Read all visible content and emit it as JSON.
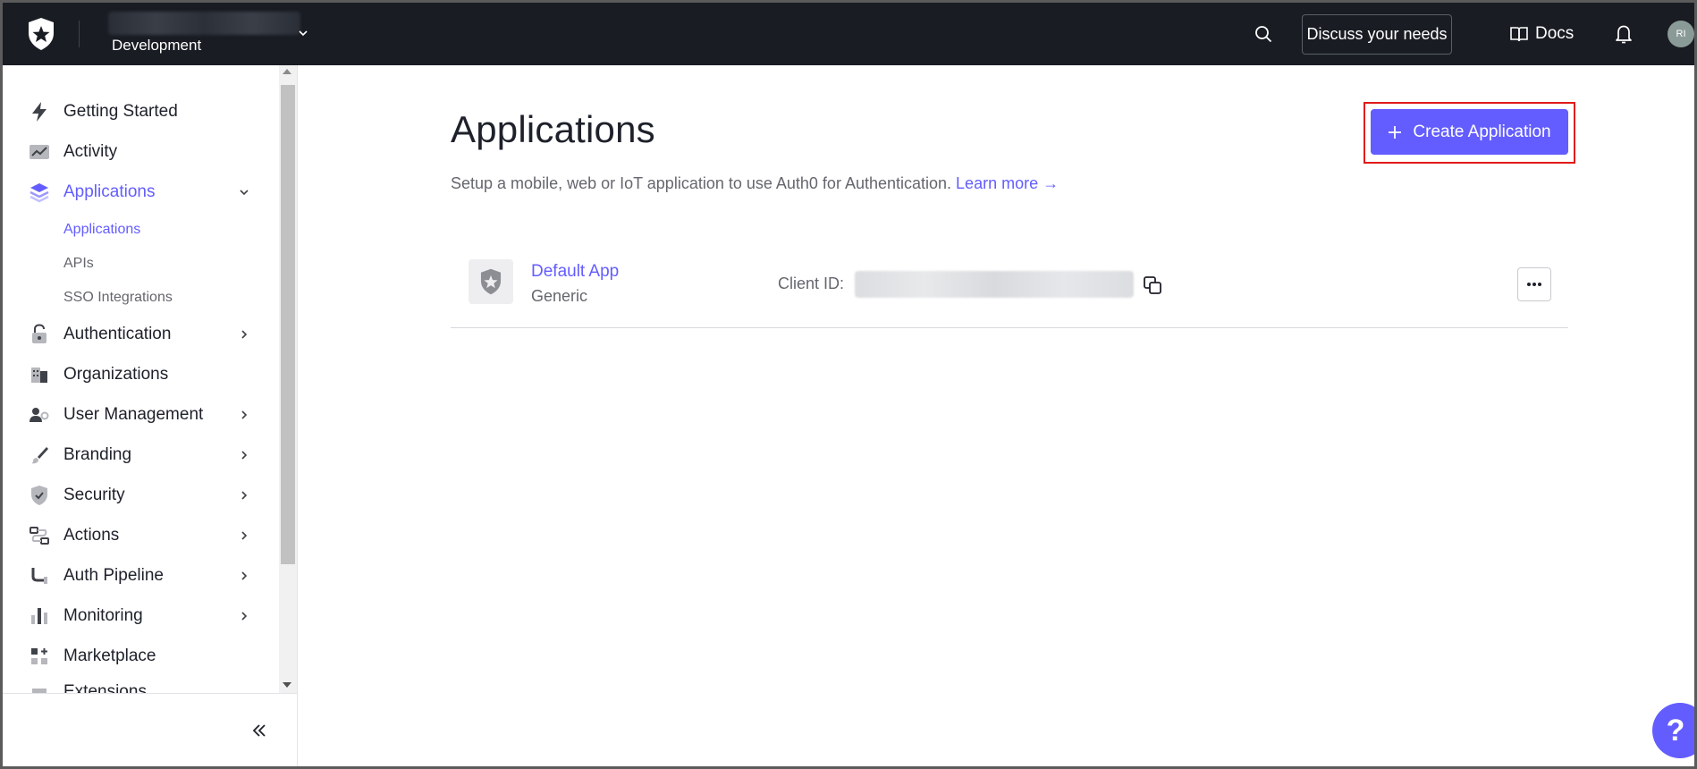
{
  "topbar": {
    "tenant_env": "Development",
    "discuss_label": "Discuss your needs",
    "docs_label": "Docs",
    "avatar_initials": "RI"
  },
  "sidebar": {
    "items": [
      {
        "label": "Getting Started",
        "icon": "bolt-icon"
      },
      {
        "label": "Activity",
        "icon": "activity-chart-icon"
      },
      {
        "label": "Applications",
        "icon": "layers-icon",
        "active": true,
        "expanded": true
      },
      {
        "label": "Authentication",
        "icon": "lock-icon"
      },
      {
        "label": "Organizations",
        "icon": "building-icon"
      },
      {
        "label": "User Management",
        "icon": "users-icon"
      },
      {
        "label": "Branding",
        "icon": "brush-icon"
      },
      {
        "label": "Security",
        "icon": "shield-icon"
      },
      {
        "label": "Actions",
        "icon": "actions-flow-icon"
      },
      {
        "label": "Auth Pipeline",
        "icon": "pipeline-icon"
      },
      {
        "label": "Monitoring",
        "icon": "bar-chart-icon"
      },
      {
        "label": "Marketplace",
        "icon": "marketplace-icon"
      },
      {
        "label": "Extensions",
        "icon": "extensions-icon"
      }
    ],
    "sub_items": [
      {
        "label": "Applications",
        "active": true
      },
      {
        "label": "APIs"
      },
      {
        "label": "SSO Integrations"
      }
    ]
  },
  "main": {
    "title": "Applications",
    "create_label": "Create Application",
    "subtitle": "Setup a mobile, web or IoT application to use Auth0 for Authentication.",
    "learn_more": "Learn more →",
    "apps": [
      {
        "name": "Default App",
        "type": "Generic",
        "client_id_label": "Client ID:",
        "client_id": ""
      }
    ]
  },
  "colors": {
    "accent": "#635dff",
    "topbar_bg": "#191c23",
    "highlight": "#e01a1a"
  }
}
